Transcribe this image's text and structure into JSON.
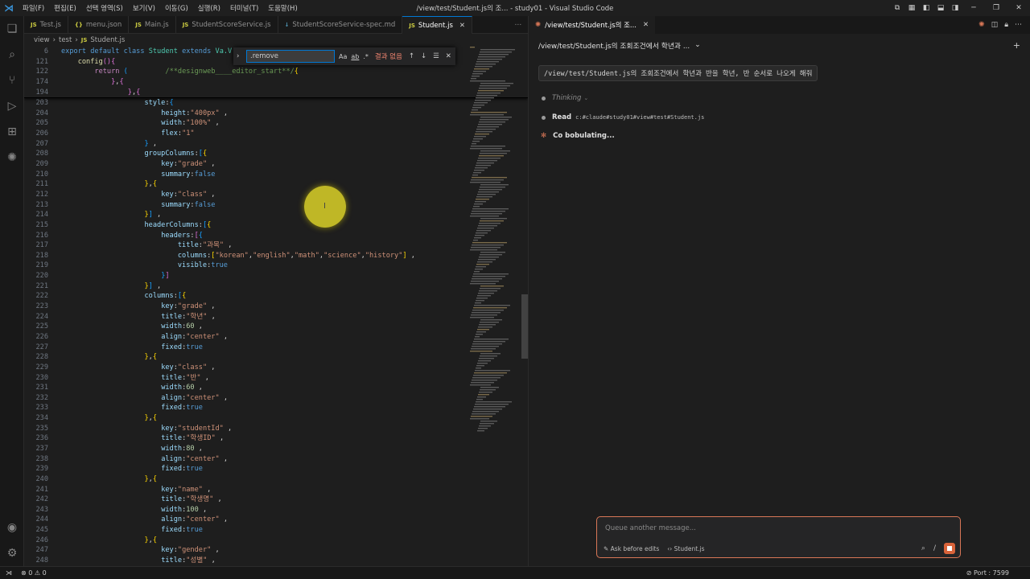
{
  "app": {
    "window_title": "/view/test/Student.js의 조... - study01 - Visual Studio Code",
    "menu": [
      "파일(F)",
      "편집(E)",
      "선택 영역(S)",
      "보기(V)",
      "이동(G)",
      "실행(R)",
      "터미널(T)",
      "도움말(H)"
    ],
    "accent_color": "#0078d4"
  },
  "tabs": [
    {
      "icon": "JS",
      "label": "Test.js",
      "active": false
    },
    {
      "icon": "{}",
      "label": "menu.json",
      "active": false
    },
    {
      "icon": "JS",
      "label": "Main.js",
      "active": false
    },
    {
      "icon": "JS",
      "label": "StudentScoreService.js",
      "active": false
    },
    {
      "icon": "↓",
      "label": "StudentScoreService-spec.md",
      "active": false
    },
    {
      "icon": "JS",
      "label": "Student.js",
      "active": true
    }
  ],
  "breadcrumb": [
    "view",
    "test",
    "Student.js"
  ],
  "find": {
    "value": ".remove",
    "options": [
      "Aa",
      "ab",
      ".*"
    ],
    "result": "결과 없음"
  },
  "sticky_lines": [
    {
      "n": "6",
      "html": "<span class='k'>export</span> <span class='k'>default</span> <span class='k'>class</span> <span class='t'>Student</span> <span class='k'>extends</span> <span class='t'>Va.V</span>"
    },
    {
      "n": "121",
      "html": "    <span class='f'>config</span><span class='pk'>()</span><span class='pk'>{</span>"
    },
    {
      "n": "122",
      "html": "        <span class='kw'>return</span> <span class='b'>(</span>         <span class='c'>/**designweb____editor_start**/</span><span class='y'>{</span>"
    },
    {
      "n": "174",
      "html": "            <span class='pk'>}</span>,<span class='pk'>{</span>"
    },
    {
      "n": "194",
      "html": "                <span class='pk'>}</span>,<span class='pk'>{</span>"
    }
  ],
  "code_lines": [
    {
      "n": "203",
      "html": "                    <span class='p'>style</span>:<span class='b'>{</span>"
    },
    {
      "n": "204",
      "html": "                        <span class='p'>height</span>:<span class='s'>\"400px\"</span> ,"
    },
    {
      "n": "205",
      "html": "                        <span class='p'>width</span>:<span class='s'>\"100%\"</span> ,"
    },
    {
      "n": "206",
      "html": "                        <span class='p'>flex</span>:<span class='s'>\"1\"</span>"
    },
    {
      "n": "207",
      "html": "                    <span class='b'>}</span> ,"
    },
    {
      "n": "208",
      "html": "                    <span class='p'>groupColumns</span>:<span class='b'>[</span><span class='y'>{</span>"
    },
    {
      "n": "209",
      "html": "                        <span class='p'>key</span>:<span class='s'>\"grade\"</span> ,"
    },
    {
      "n": "210",
      "html": "                        <span class='p'>summary</span>:<span class='k'>false</span>"
    },
    {
      "n": "211",
      "html": "                    <span class='y'>}</span>,<span class='y'>{</span>"
    },
    {
      "n": "212",
      "html": "                        <span class='p'>key</span>:<span class='s'>\"class\"</span> ,"
    },
    {
      "n": "213",
      "html": "                        <span class='p'>summary</span>:<span class='k'>false</span>"
    },
    {
      "n": "214",
      "html": "                    <span class='y'>}</span><span class='b'>]</span> ,"
    },
    {
      "n": "215",
      "html": "                    <span class='p'>headerColumns</span>:<span class='b'>[</span><span class='y'>{</span>"
    },
    {
      "n": "216",
      "html": "                        <span class='p'>headers</span>:<span class='pk'>[</span><span class='b'>{</span>"
    },
    {
      "n": "217",
      "html": "                            <span class='p'>title</span>:<span class='s'>\"과목\"</span> ,"
    },
    {
      "n": "218",
      "html": "                            <span class='p'>columns</span>:<span class='y'>[</span><span class='s'>\"korean\"</span>,<span class='s'>\"english\"</span>,<span class='s'>\"math\"</span>,<span class='s'>\"science\"</span>,<span class='s'>\"history\"</span><span class='y'>]</span> ,"
    },
    {
      "n": "219",
      "html": "                            <span class='p'>visible</span>:<span class='k'>true</span>"
    },
    {
      "n": "220",
      "html": "                        <span class='b'>}</span><span class='pk'>]</span>"
    },
    {
      "n": "221",
      "html": "                    <span class='y'>}</span><span class='b'>]</span> ,"
    },
    {
      "n": "222",
      "html": "                    <span class='p'>columns</span>:<span class='b'>[</span><span class='y'>{</span>"
    },
    {
      "n": "223",
      "html": "                        <span class='p'>key</span>:<span class='s'>\"grade\"</span> ,"
    },
    {
      "n": "224",
      "html": "                        <span class='p'>title</span>:<span class='s'>\"학년\"</span> ,"
    },
    {
      "n": "225",
      "html": "                        <span class='p'>width</span>:<span class='n'>60</span> ,"
    },
    {
      "n": "226",
      "html": "                        <span class='p'>align</span>:<span class='s'>\"center\"</span> ,"
    },
    {
      "n": "227",
      "html": "                        <span class='p'>fixed</span>:<span class='k'>true</span>"
    },
    {
      "n": "228",
      "html": "                    <span class='y'>}</span>,<span class='y'>{</span>"
    },
    {
      "n": "229",
      "html": "                        <span class='p'>key</span>:<span class='s'>\"class\"</span> ,"
    },
    {
      "n": "230",
      "html": "                        <span class='p'>title</span>:<span class='s'>\"반\"</span> ,"
    },
    {
      "n": "231",
      "html": "                        <span class='p'>width</span>:<span class='n'>60</span> ,"
    },
    {
      "n": "232",
      "html": "                        <span class='p'>align</span>:<span class='s'>\"center\"</span> ,"
    },
    {
      "n": "233",
      "html": "                        <span class='p'>fixed</span>:<span class='k'>true</span>"
    },
    {
      "n": "234",
      "html": "                    <span class='y'>}</span>,<span class='y'>{</span>"
    },
    {
      "n": "235",
      "html": "                        <span class='p'>key</span>:<span class='s'>\"studentId\"</span> ,"
    },
    {
      "n": "236",
      "html": "                        <span class='p'>title</span>:<span class='s'>\"학생ID\"</span> ,"
    },
    {
      "n": "237",
      "html": "                        <span class='p'>width</span>:<span class='n'>80</span> ,"
    },
    {
      "n": "238",
      "html": "                        <span class='p'>align</span>:<span class='s'>\"center\"</span> ,"
    },
    {
      "n": "239",
      "html": "                        <span class='p'>fixed</span>:<span class='k'>true</span>"
    },
    {
      "n": "240",
      "html": "                    <span class='y'>}</span>,<span class='y'>{</span>"
    },
    {
      "n": "241",
      "html": "                        <span class='p'>key</span>:<span class='s'>\"name\"</span> ,"
    },
    {
      "n": "242",
      "html": "                        <span class='p'>title</span>:<span class='s'>\"학생명\"</span> ,"
    },
    {
      "n": "243",
      "html": "                        <span class='p'>width</span>:<span class='n'>100</span> ,"
    },
    {
      "n": "244",
      "html": "                        <span class='p'>align</span>:<span class='s'>\"center\"</span> ,"
    },
    {
      "n": "245",
      "html": "                        <span class='p'>fixed</span>:<span class='k'>true</span>"
    },
    {
      "n": "246",
      "html": "                    <span class='y'>}</span>,<span class='y'>{</span>"
    },
    {
      "n": "247",
      "html": "                        <span class='p'>key</span>:<span class='s'>\"gender\"</span> ,"
    },
    {
      "n": "248",
      "html": "                        <span class='p'>title</span>:<span class='s'>\"성별\"</span> ,"
    }
  ],
  "chat": {
    "tab_label": "/view/test/Student.js의 조...",
    "header_title": "/view/test/Student.js의 조회조건에서 학년과 ...",
    "user_message": "/view/test/Student.js의 조회조건에서 학년과 반을 학년, 반 순서로 나오게 해줘",
    "thinking_label": "Thinking",
    "read_label": "Read",
    "read_path": "c:#claude#study01#view#test#Student.js",
    "status_text": "Co bobulating...",
    "input_placeholder": "Queue another message...",
    "mode_label": "Ask before edits",
    "file_label": "Student.js",
    "accent_color": "#d97757"
  },
  "status": {
    "problems": "0",
    "warnings": "0",
    "port": "Port : 7599"
  }
}
